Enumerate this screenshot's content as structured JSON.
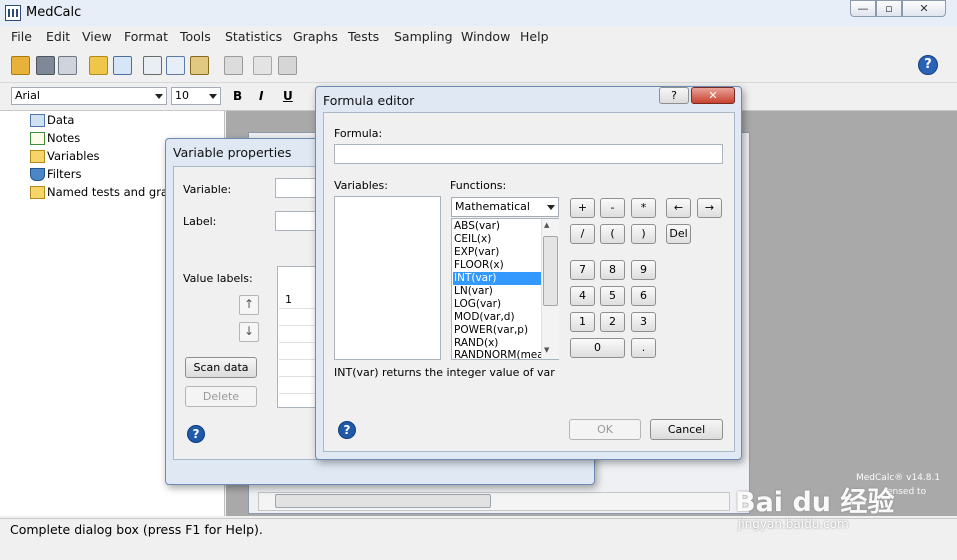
{
  "app": {
    "title": "MedCalc"
  },
  "window_controls": {
    "minimize": "—",
    "maximize": "▫",
    "close": "✕"
  },
  "menu": [
    "File",
    "Edit",
    "View",
    "Format",
    "Tools",
    "Statistics",
    "Graphs",
    "Tests",
    "Sampling",
    "Window",
    "Help"
  ],
  "format_bar": {
    "font": "Arial",
    "size": "10",
    "bold": "B",
    "italic": "I",
    "underline": "U"
  },
  "tree": [
    "Data",
    "Notes",
    "Variables",
    "Filters",
    "Named tests and grap"
  ],
  "status": "Complete dialog box (press F1 for Help).",
  "variable_properties": {
    "title": "Variable properties",
    "variable_label": "Variable:",
    "label_label": "Label:",
    "value_labels": "Value labels:",
    "first_row": "1",
    "scan_data": "Scan data",
    "delete": "Delete"
  },
  "formula_editor": {
    "title": "Formula editor",
    "help_btn": "?",
    "close_btn": "✕",
    "formula_label": "Formula:",
    "formula_value": "",
    "variables_label": "Variables:",
    "functions_label": "Functions:",
    "category": "Mathematical",
    "functions": [
      "ABS(var)",
      "CEIL(x)",
      "EXP(var)",
      "FLOOR(x)",
      "INT(var)",
      "LN(var)",
      "LOG(var)",
      "MOD(var,d)",
      "POWER(var,p)",
      "RAND(x)",
      "RANDNORM(mear"
    ],
    "selected_function": "INT(var)",
    "description": "INT(var) returns the integer value of var",
    "keypad": {
      "plus": "+",
      "minus": "-",
      "mult": "*",
      "div": "/",
      "lparen": "(",
      "rparen": ")",
      "left": "←",
      "right": "→",
      "del": "Del",
      "n7": "7",
      "n8": "8",
      "n9": "9",
      "n4": "4",
      "n5": "5",
      "n6": "6",
      "n1": "1",
      "n2": "2",
      "n3": "3",
      "n0": "0",
      "dot": "."
    },
    "ok": "OK",
    "cancel": "Cancel"
  },
  "watermark": {
    "brand": "Bai du 经验",
    "url": "jingyan.baidu.com",
    "version": "MedCalc® v14.8.1",
    "licensed": "ensed to"
  }
}
